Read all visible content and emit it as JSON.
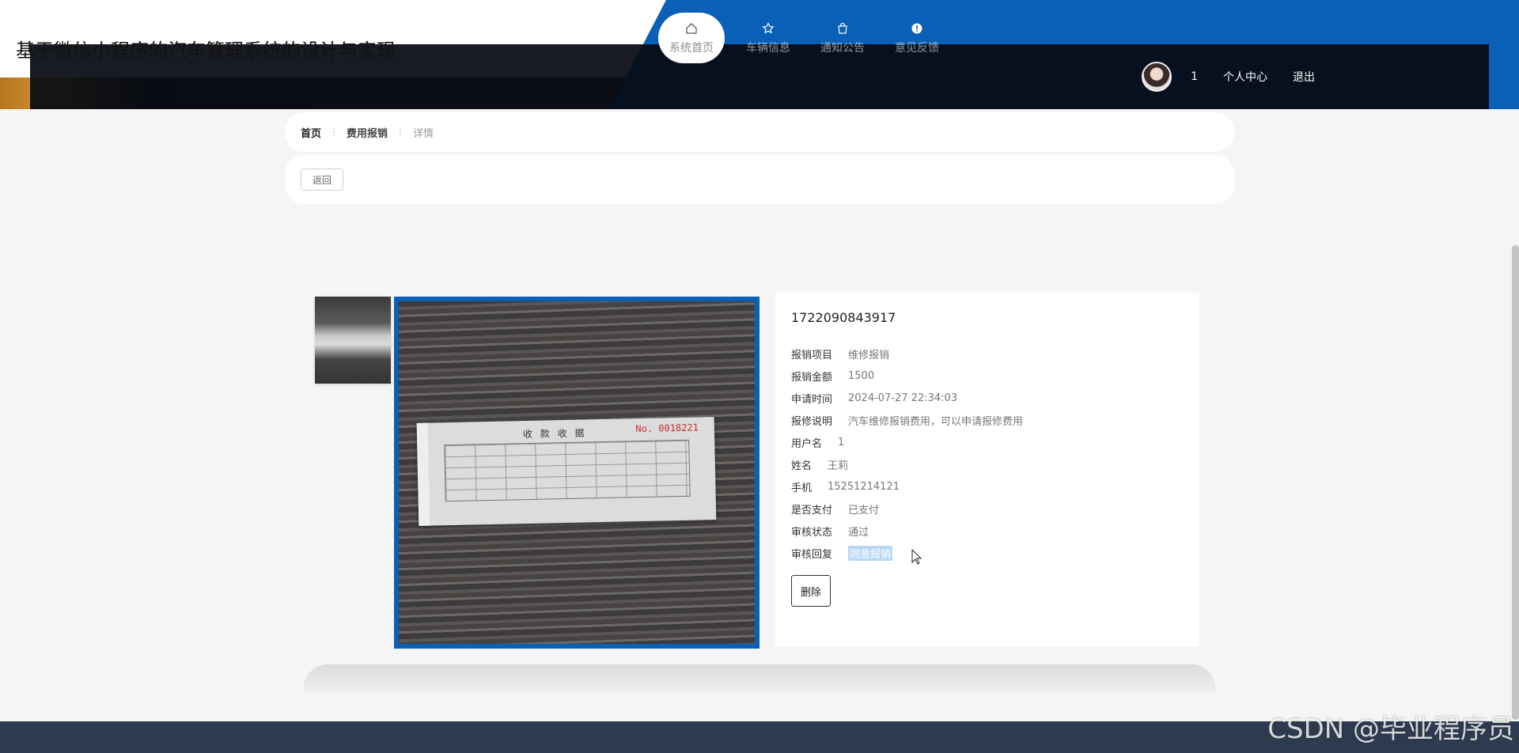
{
  "header": {
    "site_title": "基于微信小程序的汽车管理系统的设计与实现",
    "nav": [
      {
        "label": "系统首页",
        "icon": "home-icon"
      },
      {
        "label": "车辆信息",
        "icon": "star-icon"
      },
      {
        "label": "通知公告",
        "icon": "bag-icon"
      },
      {
        "label": "意见反馈",
        "icon": "alert-icon"
      }
    ],
    "user": {
      "name": "1",
      "profile_label": "个人中心",
      "logout_label": "退出"
    }
  },
  "breadcrumb": {
    "home": "首页",
    "section": "费用报销",
    "current": "详情",
    "separator": "⋮"
  },
  "toolbar": {
    "back_label": "返回"
  },
  "detail": {
    "title": "1722090843917",
    "fields": [
      {
        "label": "报销项目",
        "value": "维修报销"
      },
      {
        "label": "报销金额",
        "value": "1500"
      },
      {
        "label": "申请时间",
        "value": "2024-07-27 22:34:03"
      },
      {
        "label": "报修说明",
        "value": "汽车维修报销费用，可以申请报修费用"
      },
      {
        "label": "用户名",
        "value": "1"
      },
      {
        "label": "姓名",
        "value": "王莉"
      },
      {
        "label": "手机",
        "value": "15251214121"
      },
      {
        "label": "是否支付",
        "value": "已支付"
      },
      {
        "label": "审核状态",
        "value": "通过"
      },
      {
        "label": "审核回复",
        "value": "同意报销"
      }
    ],
    "delete_label": "删除"
  },
  "receipt": {
    "title": "收 款 收 据",
    "number": "No. 0018221"
  },
  "watermark": "CSDN @毕业程序员",
  "colors": {
    "accent": "#0a5fb7",
    "footer": "#2e3a4f"
  }
}
